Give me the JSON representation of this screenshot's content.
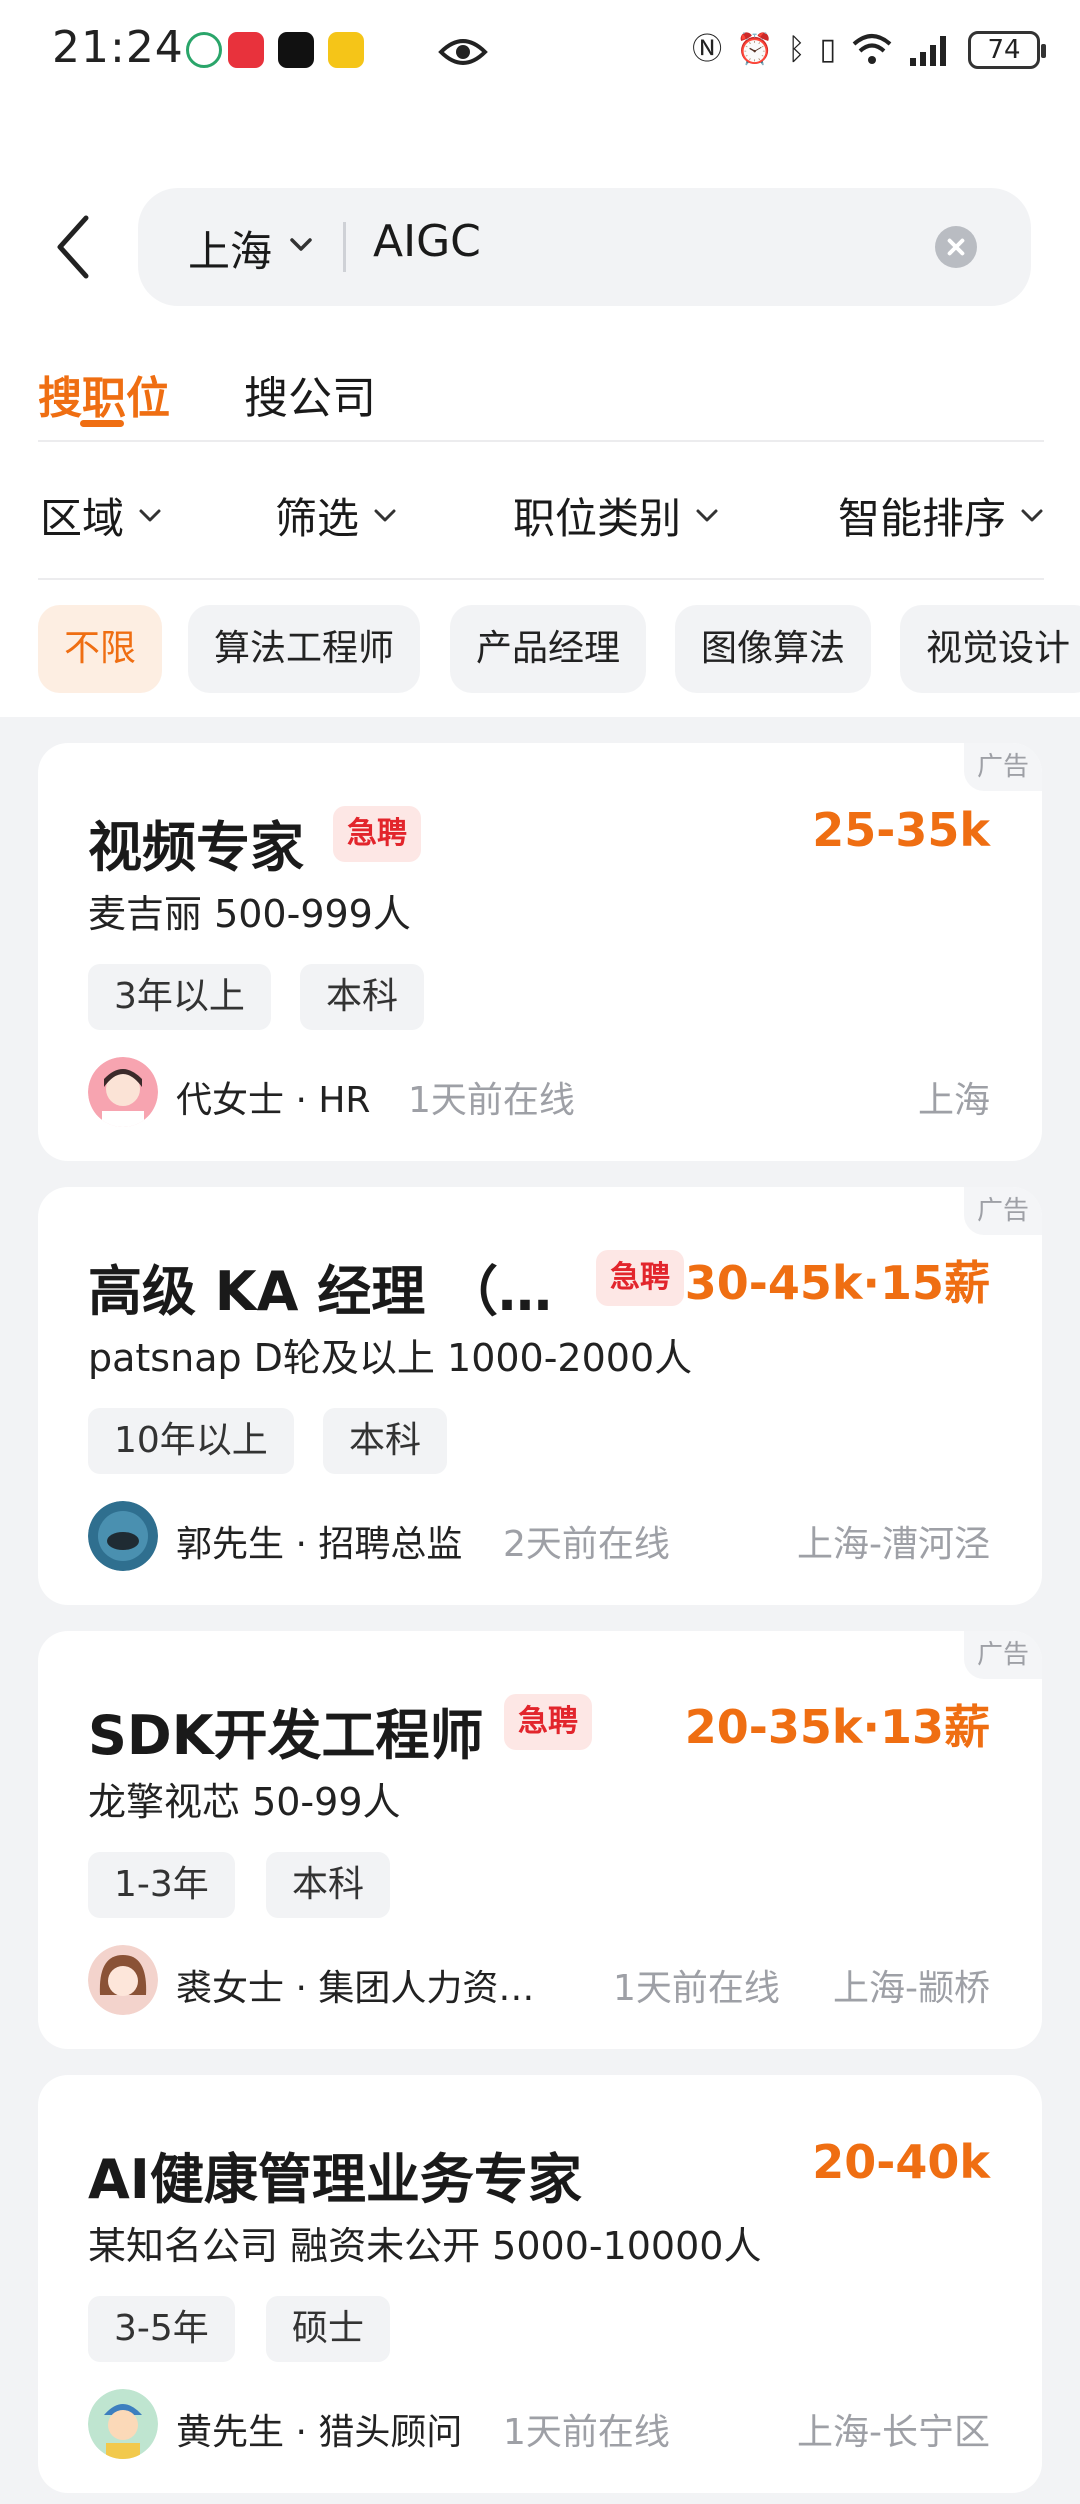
{
  "status_bar": {
    "time": "21:24",
    "battery": "74",
    "icons": [
      "nfc-icon",
      "alarm-icon",
      "bluetooth-icon",
      "vibrate-icon",
      "wifi-icon",
      "signal-icon"
    ]
  },
  "search": {
    "city": "上海",
    "query": "AIGC"
  },
  "tabs": [
    {
      "label": "搜职位",
      "active": true
    },
    {
      "label": "搜公司",
      "active": false
    }
  ],
  "filters": [
    "区域",
    "筛选",
    "职位类别",
    "智能排序"
  ],
  "chips": [
    "不限",
    "算法工程师",
    "产品经理",
    "图像算法",
    "视觉设计"
  ],
  "jobs": [
    {
      "ad_label": "广告",
      "title": "视频专家",
      "urgent": "急聘",
      "salary": "25-35k",
      "company": "麦吉丽  500-999人",
      "tags": [
        "3年以上",
        "本科"
      ],
      "recruiter": "代女士 · HR",
      "online": "1天前在线",
      "location": "上海"
    },
    {
      "ad_label": "广告",
      "title": "高级 KA 经理 （…",
      "urgent": "急聘",
      "salary": "30-45k·15薪",
      "company": "patsnap  D轮及以上  1000-2000人",
      "tags": [
        "10年以上",
        "本科"
      ],
      "recruiter": "郭先生 · 招聘总监",
      "online": "2天前在线",
      "location": "上海-漕河泾"
    },
    {
      "ad_label": "广告",
      "title": "SDK开发工程师",
      "urgent": "急聘",
      "salary": "20-35k·13薪",
      "company": "龙擎视芯  50-99人",
      "tags": [
        "1-3年",
        "本科"
      ],
      "recruiter": "裘女士 · 集团人力资…",
      "online": "1天前在线",
      "location": "上海-颛桥"
    },
    {
      "title": "AI健康管理业务专家",
      "salary": "20-40k",
      "company": "某知名公司  融资未公开  5000-10000人",
      "tags": [
        "3-5年",
        "硕士"
      ],
      "recruiter": "黄先生 · 猎头顾问",
      "online": "1天前在线",
      "location": "上海-长宁区"
    }
  ]
}
